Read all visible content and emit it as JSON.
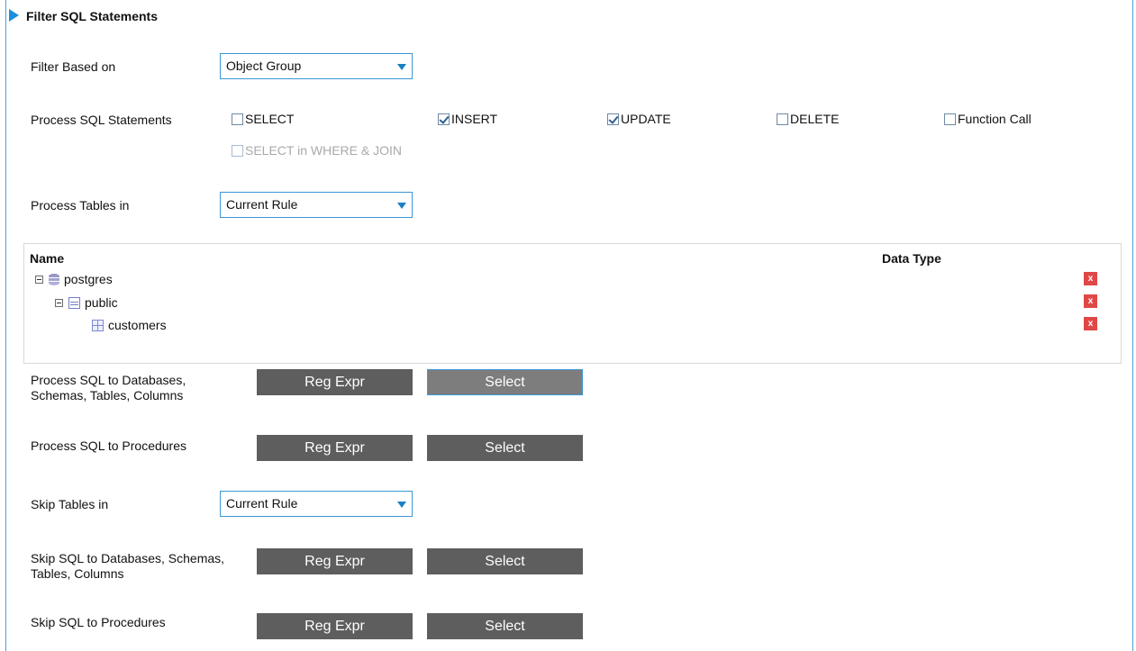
{
  "section": {
    "title": "Filter SQL Statements"
  },
  "filter_based_on": {
    "label": "Filter Based on",
    "value": "Object Group"
  },
  "process_sql_statements": {
    "label": "Process SQL Statements",
    "options": [
      {
        "label": "SELECT",
        "checked": false
      },
      {
        "label": "INSERT",
        "checked": true
      },
      {
        "label": "UPDATE",
        "checked": true
      },
      {
        "label": "DELETE",
        "checked": false
      },
      {
        "label": "Function Call",
        "checked": false
      }
    ],
    "sub_option": {
      "label": "SELECT in WHERE & JOIN",
      "checked": false,
      "disabled": true
    }
  },
  "process_tables_in": {
    "label": "Process Tables in",
    "value": "Current Rule"
  },
  "tree": {
    "columns": {
      "name": "Name",
      "data_type": "Data Type"
    },
    "nodes": [
      {
        "label": "postgres",
        "type": "database"
      },
      {
        "label": "public",
        "type": "schema"
      },
      {
        "label": "customers",
        "type": "table"
      }
    ],
    "delete_label": "x"
  },
  "rows": [
    {
      "label": "Process SQL to Databases, Schemas, Tables, Columns",
      "reg_expr": "Reg Expr",
      "select": "Select"
    },
    {
      "label": "Process SQL to Procedures",
      "reg_expr": "Reg Expr",
      "select": "Select"
    },
    {
      "label": "Skip SQL to Databases, Schemas, Tables, Columns",
      "reg_expr": "Reg Expr",
      "select": "Select"
    },
    {
      "label": "Skip SQL to Procedures",
      "reg_expr": "Reg Expr",
      "select": "Select"
    }
  ],
  "skip_tables_in": {
    "label": "Skip Tables in",
    "value": "Current Rule"
  },
  "colors": {
    "accent": "#1a8fdc",
    "button": "#5e5e5e",
    "delete": "#e04848"
  }
}
